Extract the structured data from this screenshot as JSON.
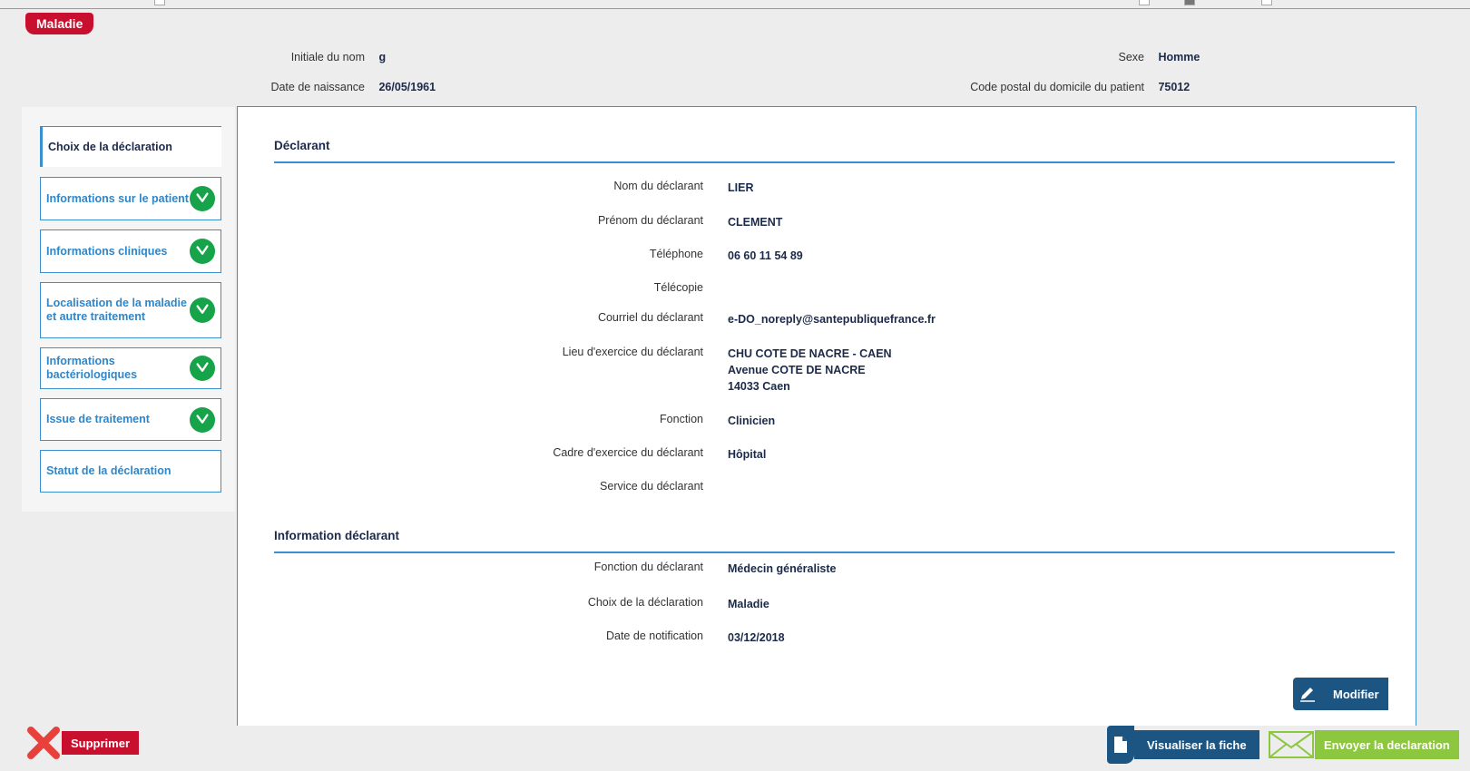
{
  "tab": {
    "label": "Maladie"
  },
  "patient": {
    "initial_label": "Initiale du nom",
    "initial_value": "g",
    "birth_label": "Date de naissance",
    "birth_value": "26/05/1961",
    "sex_label": "Sexe",
    "sex_value": "Homme",
    "postal_label": "Code postal du domicile du patient",
    "postal_value": "75012"
  },
  "sidebar": {
    "items": [
      {
        "label": "Choix de la déclaration",
        "done": false
      },
      {
        "label": "Informations sur le patient",
        "done": true
      },
      {
        "label": "Informations cliniques",
        "done": true
      },
      {
        "label": "Localisation de la maladie et autre traitement",
        "done": true
      },
      {
        "label": "Informations bactériologiques",
        "done": true
      },
      {
        "label": "Issue de traitement",
        "done": true
      },
      {
        "label": "Statut de la déclaration",
        "done": false
      }
    ]
  },
  "declarant": {
    "title": "Déclarant",
    "fields": [
      {
        "label": "Nom du déclarant",
        "value": "LIER"
      },
      {
        "label": "Prénom du déclarant",
        "value": "CLEMENT"
      },
      {
        "label": "Téléphone",
        "value": "06 60 11 54 89"
      },
      {
        "label": "Télécopie",
        "value": ""
      },
      {
        "label": "Courriel du déclarant",
        "value": "e-DO_noreply@santepubliquefrance.fr"
      },
      {
        "label": "Lieu d'exercice du déclarant",
        "value_line1": "CHU COTE DE NACRE - CAEN",
        "value_line2": "Avenue COTE DE NACRE",
        "value_line3": "14033 Caen"
      },
      {
        "label": "Fonction",
        "value": "Clinicien"
      },
      {
        "label": "Cadre d'exercice du déclarant",
        "value": "Hôpital"
      },
      {
        "label": "Service du déclarant",
        "value": ""
      }
    ]
  },
  "info": {
    "title": "Information déclarant",
    "fields": [
      {
        "label": "Fonction du déclarant",
        "value": "Médecin généraliste"
      },
      {
        "label": "Choix de la déclaration",
        "value": "Maladie"
      },
      {
        "label": "Date de notification",
        "value": "03/12/2018"
      }
    ]
  },
  "buttons": {
    "modifier": "Modifier",
    "supprimer": "Supprimer",
    "visualiser": "Visualiser la fiche",
    "envoyer": "Envoyer la declaration"
  },
  "colors": {
    "brand_red": "#c8102e",
    "accent_blue": "#3a8fcf",
    "dark_blue": "#1d5582",
    "check_green": "#16a34a",
    "send_green": "#8dc63f"
  },
  "icons": {
    "check": "check-icon",
    "edit": "pencil-icon",
    "delete": "cross-icon",
    "document": "document-icon",
    "mail": "envelope-icon"
  }
}
